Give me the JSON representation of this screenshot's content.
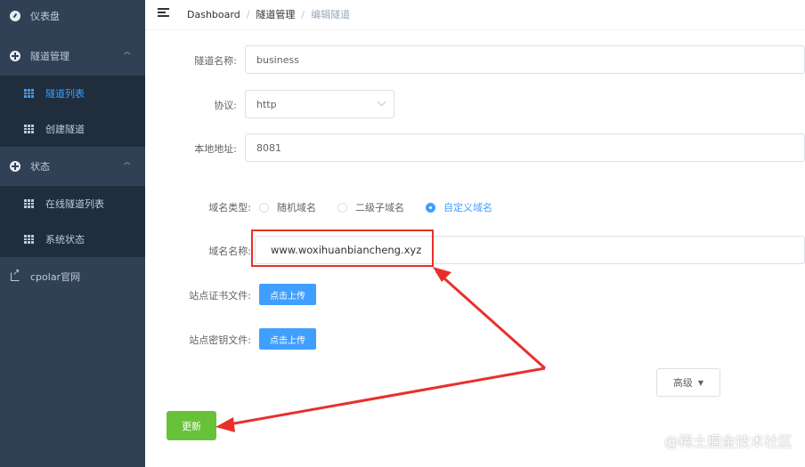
{
  "sidebar": {
    "items": [
      {
        "label": "仪表盘",
        "icon": "dashboard-icon"
      },
      {
        "label": "隧道管理",
        "icon": "plus-circle-icon"
      },
      {
        "label": "隧道列表",
        "icon": "grid-icon",
        "active": true
      },
      {
        "label": "创建隧道",
        "icon": "grid-icon"
      },
      {
        "label": "状态",
        "icon": "plus-circle-icon"
      },
      {
        "label": "在线隧道列表",
        "icon": "grid-icon"
      },
      {
        "label": "系统状态",
        "icon": "grid-icon"
      },
      {
        "label": "cpolar官网",
        "icon": "external-link-icon"
      }
    ],
    "colors": {
      "bg": "#304156",
      "sub_bg": "#1f2d3d",
      "active": "#409eff"
    }
  },
  "header": {
    "breadcrumb": [
      "Dashboard",
      "隧道管理",
      "编辑隧道"
    ],
    "sep": "/"
  },
  "form": {
    "tunnel_name_label": "隧道名称:",
    "tunnel_name_value": "business",
    "protocol_label": "协议:",
    "protocol_value": "http",
    "local_addr_label": "本地地址:",
    "local_addr_value": "8081",
    "domain_type_label": "域名类型:",
    "domain_types": [
      "随机域名",
      "二级子域名",
      "自定义域名"
    ],
    "domain_type_selected": "自定义域名",
    "domain_name_label": "域名名称:",
    "domain_name_value": "www.woxihuanbiancheng.xyz",
    "cert_label": "站点证书文件:",
    "cert_button": "点击上传",
    "key_label": "站点密钥文件:",
    "key_button": "点击上传",
    "advanced_button": "高级",
    "update_button": "更新"
  },
  "watermark": "@稀土掘金技术社区",
  "colors": {
    "primary": "#409eff",
    "success": "#67c23a",
    "annotation": "#e8302a"
  }
}
